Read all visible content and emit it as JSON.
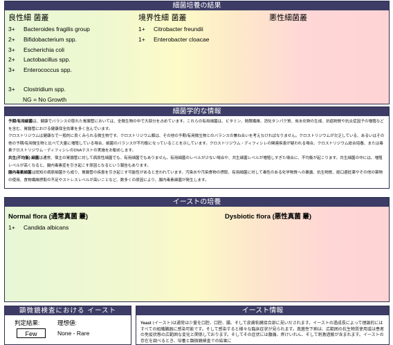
{
  "bacteria_panel": {
    "title": "細菌培養の結果",
    "col_normal": "良性細 菌叢",
    "col_borderline": "境界性細 菌叢",
    "col_dysbiotic": "悪性細菌叢",
    "normal_rows": [
      {
        "level": "3+",
        "name": "Bacteroides fragilis group"
      },
      {
        "level": "2+",
        "name": "Bifidobacterium spp."
      },
      {
        "level": "3+",
        "name": "Escherichia coli"
      },
      {
        "level": "2+",
        "name": "Lactobacillus spp."
      },
      {
        "level": "3+",
        "name": "Enterococcus spp."
      },
      {
        "level": "3+",
        "name": "Clostridium spp."
      }
    ],
    "borderline_rows": [
      {
        "level": "1+",
        "name": "Citrobacter freundii"
      },
      {
        "level": "1+",
        "name": "Enterobacter cloacae"
      }
    ],
    "footnote": "NG = No Growth"
  },
  "micro_panel": {
    "title": "細菌学的な情報",
    "paragraphs": [
      {
        "bold": "予期/有用細菌",
        "text": "は、健康でバランスの取れた胃腸管においては、全微生物の中で大部分を占めています。これらの有用細菌は、ビタミン、発酵繊維、消化タンパク質、炭水化物の生成、抗癌物質や抗炎症因子の増殖などを含む、胃腸管における健康保全効果を多く含んでいます。"
      },
      {
        "bold": "",
        "text": "クロストリジウムは健康なで一般的に良くみられる微生物です。クロストリジウム類は、その他の予期/有用微生物とのバランスの兼ね合いを考えなければなりません。クロストリジウムが欠乏している、あるいはその他の予期/有用微生物と比べて大量に増殖している場合、細菌のバランスが不均衡になっていることを示しています。クロストリジウム・ディフィシレの関連疾患が疑われる場合、クロストリジウム総合培養、または毒素クロストリジウム・ディフィシレのDNAテストの実施をお勧めします。"
      },
      {
        "bold": "共生(不均衡) 細菌",
        "text": "は通常、宿主の胃腸管に対して病原性細菌でも、有用細菌でもありません。有用細菌のレベルが少ない場合や、共生細菌レベルが増殖しすぎた場合に、不均衡が起こります。共生細菌の中には、増殖レベルが高くなると、腸内毒素症を引き起こす原因となるという報告もあります。"
      },
      {
        "bold": "腸内毒素細菌",
        "text": "は既知の病原細菌から成り、胃腸管の疾患を引き起こす可能性があると言われています。汚染水や汚染食物の摂取、有用細菌に対して毒性のある化学物質への暴露、抗生物質、経口避妊薬やその他の薬物の使用、食物繊維摂取の不足やストレスレベルが高いことなど、数多くの原因により、腸内毒素細菌が発生します。"
      }
    ]
  },
  "yeast_panel": {
    "title": "イーストの培養",
    "col_normal": "Normal flora (通常真菌 叢)",
    "col_dysbiotic": "Dysbiotic flora (悪性真菌 叢)",
    "rows": [
      {
        "level": "1+",
        "name": "Candida albicans"
      }
    ]
  },
  "microscopy_panel": {
    "title": "顕微鏡検査における イースト",
    "result_label": "判定結果:",
    "expected_label": "理想値:",
    "result_value": "Few",
    "expected_value": "None - Rare"
  },
  "yeast_info_panel": {
    "title": "イースト情報",
    "bold": "Yeast",
    "text": " (イースト)は通常は少量を口腔、口腔、腸、そして皮膚粘膜接合部に見いだされます。イーストの過成長によって理論的にはすべての組織臓器に感染可能です。そして感染すると様々な臨床症状が見られます。真菌性下痢は、広範囲の抗生物質使用或は患者の免疫状態の広範囲な変化と関係しております。そしてその症状には腹痛、疼けいれん、そして刺激過敏が含まれます。イーストの存在を調べるとき、培養と顕微鏡検査での結果に"
  }
}
